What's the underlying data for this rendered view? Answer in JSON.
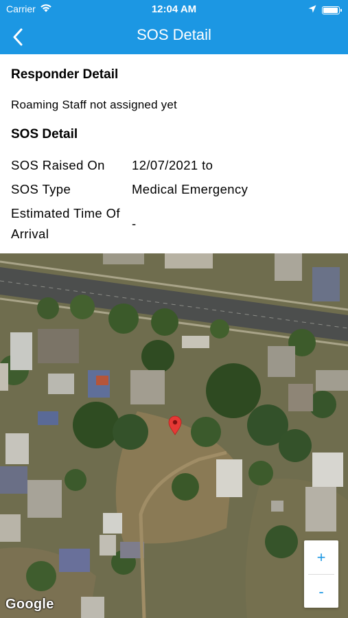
{
  "status_bar": {
    "carrier": "Carrier",
    "time": "12:04 AM",
    "battery_level": 0.95
  },
  "nav": {
    "title": "SOS Detail",
    "back_icon": "chevron-left-icon"
  },
  "responder": {
    "heading": "Responder Detail",
    "status": "Roaming Staff not assigned yet"
  },
  "sos": {
    "heading": "SOS Detail",
    "rows": [
      {
        "label": "SOS Raised On",
        "value": "12/07/2021 to"
      },
      {
        "label": "SOS Type",
        "value": "Medical Emergency"
      },
      {
        "label": "Estimated Time Of Arrival",
        "value": "-"
      }
    ]
  },
  "map": {
    "zoom_in": "+",
    "zoom_out": "-",
    "attribution": "Google",
    "marker_color": "#e53935"
  },
  "colors": {
    "header": "#1c97e3",
    "accent": "#1c97e3"
  }
}
